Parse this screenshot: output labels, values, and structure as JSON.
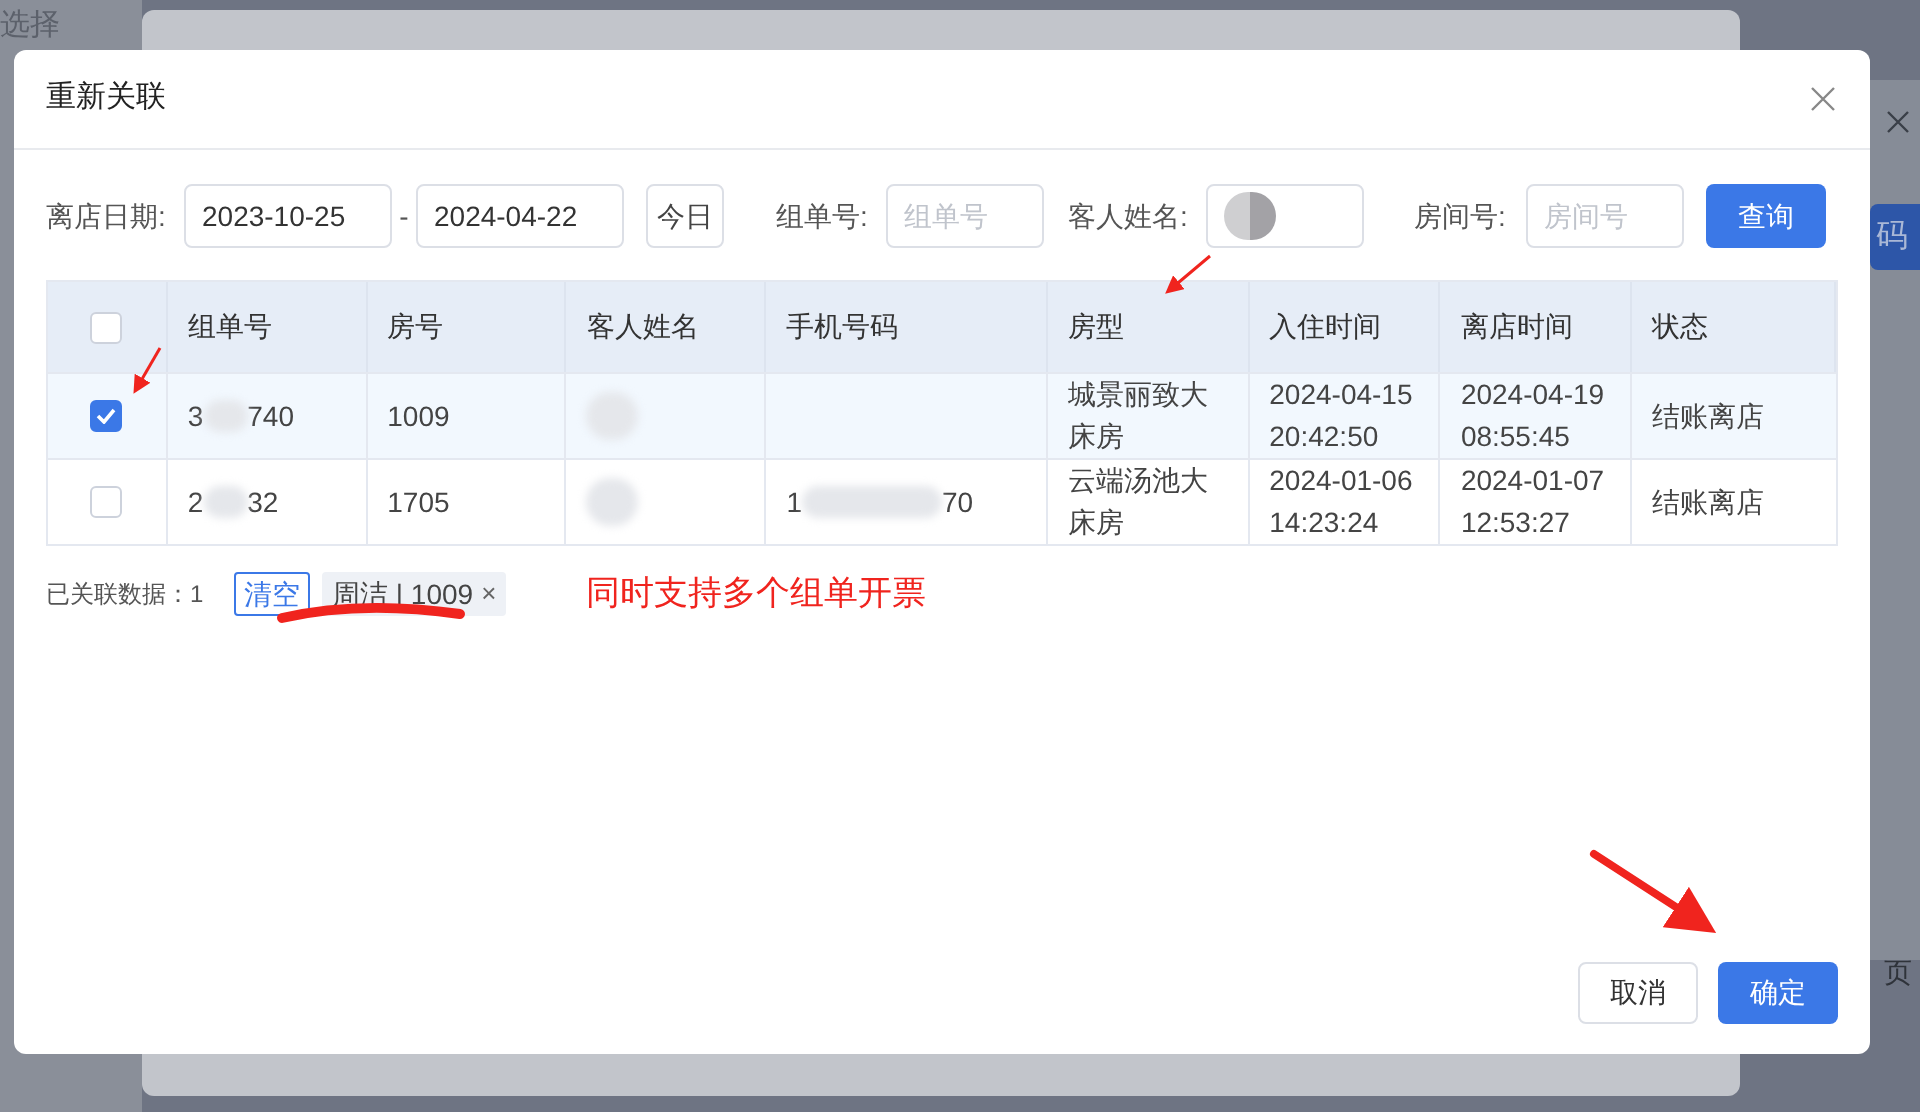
{
  "background": {
    "corner_label": "选择",
    "side_button": "码",
    "pager_label": "页"
  },
  "dialog": {
    "title": "重新关联"
  },
  "filters": {
    "date_label": "离店日期:",
    "date_start": "2023-10-25",
    "date_separator": "-",
    "date_end": "2024-04-22",
    "today_button": "今日",
    "order_label": "组单号:",
    "order_placeholder": "组单号",
    "guest_label": "客人姓名:",
    "room_label": "房间号:",
    "room_placeholder": "房间号",
    "query_button": "查询"
  },
  "table": {
    "select_all_checked": false,
    "columns": [
      "组单号",
      "房号",
      "客人姓名",
      "手机号码",
      "房型",
      "入住时间",
      "离店时间",
      "状态"
    ],
    "rows": [
      {
        "selected": true,
        "order_no": {
          "head": "3",
          "tail": "740"
        },
        "room": "1009",
        "room_type": "城景丽致大床房",
        "check_in": "2024-04-15 20:42:50",
        "check_out": "2024-04-19 08:55:45",
        "status": "结账离店"
      },
      {
        "selected": false,
        "order_no": {
          "head": "2",
          "tail": "32"
        },
        "room": "1705",
        "phone": {
          "head": "1",
          "tail": "70"
        },
        "room_type": "云端汤池大床房",
        "check_in": "2024-01-06 14:23:24",
        "check_out": "2024-01-07 12:53:27",
        "status": "结账离店"
      }
    ]
  },
  "linked": {
    "label": "已关联数据：1",
    "clear_button": "清空",
    "tags": [
      {
        "label": "周洁 | 1009",
        "close": "×"
      }
    ]
  },
  "annotation": {
    "text": "同时支持多个组单开票"
  },
  "footer": {
    "cancel_button": "取消",
    "confirm_button": "确定"
  }
}
